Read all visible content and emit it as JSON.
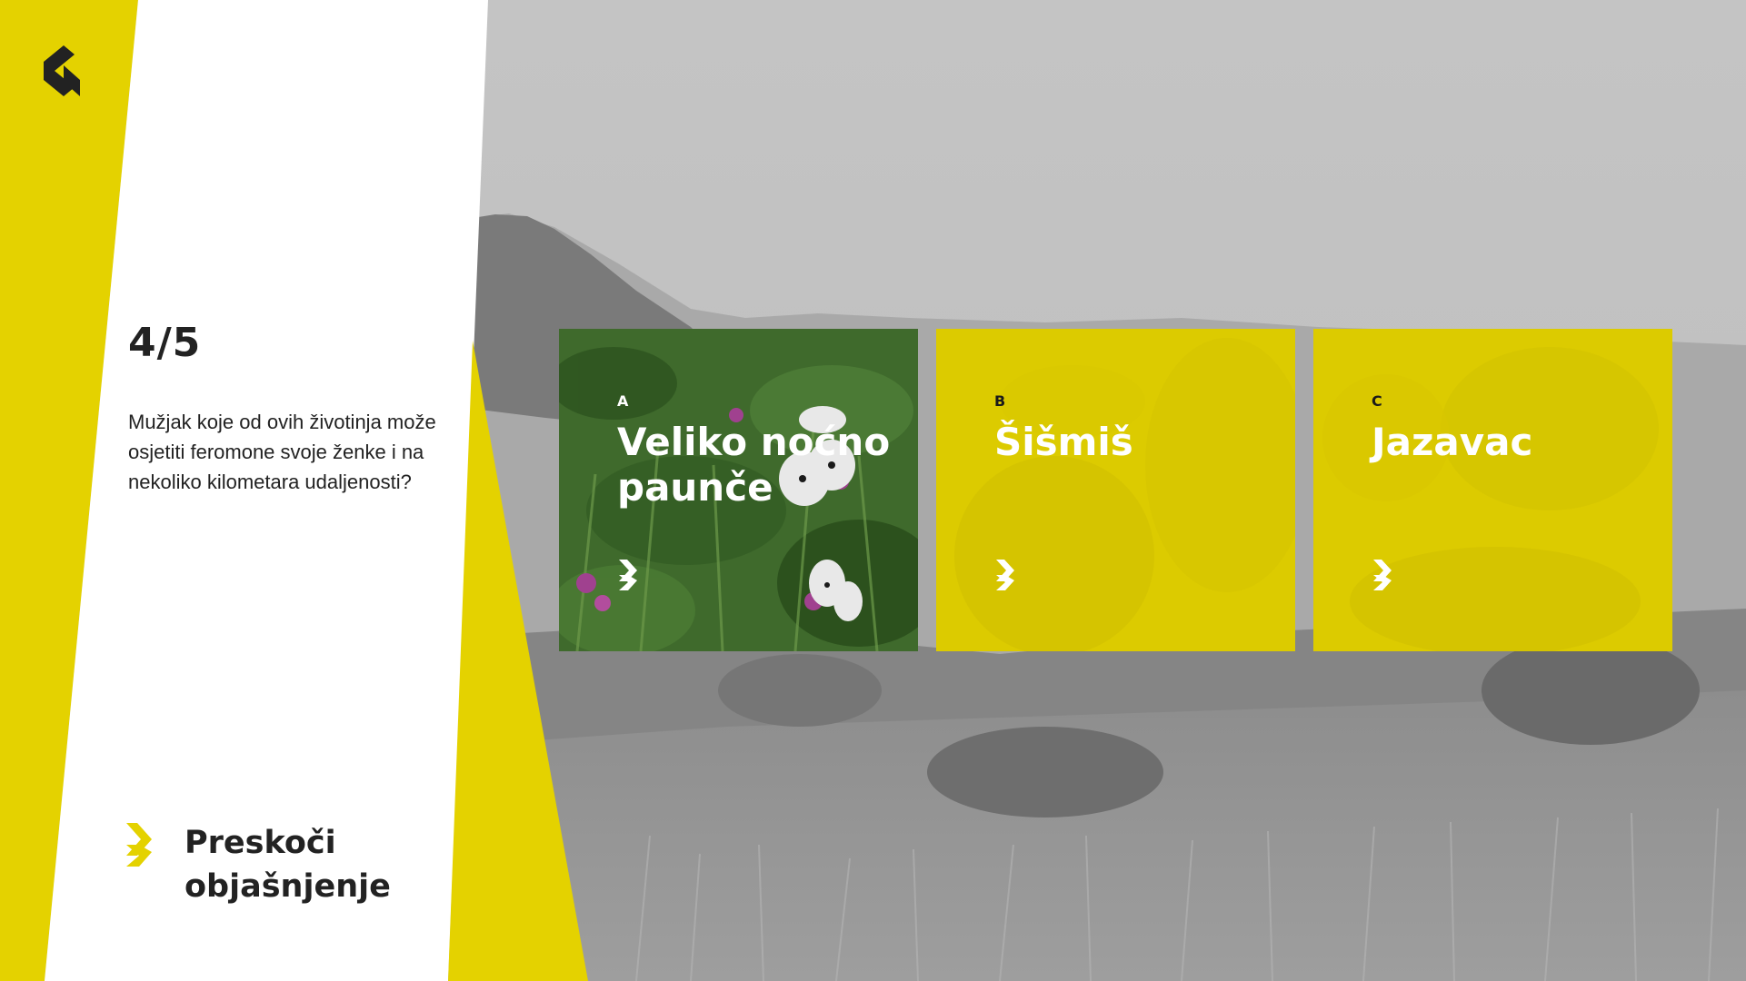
{
  "quiz": {
    "progress": "4/5",
    "question": "Mužjak koje od ovih životinja može osjetiti feromone svoje ženke i na nekoliko kilometara udaljenosti?",
    "skip_label": "Preskoči objašnjenje"
  },
  "answers": [
    {
      "letter": "A",
      "title": "Veliko noćno paunče"
    },
    {
      "letter": "B",
      "title": "Šišmiš"
    },
    {
      "letter": "C",
      "title": "Jazavac"
    }
  ],
  "colors": {
    "accent": "#e4d200",
    "card_yellow": "#dccb00",
    "text_dark": "#222222",
    "panel_white": "#ffffff"
  },
  "icons": {
    "back": "chevron-left-icon",
    "skip": "chevron-right-icon",
    "card_arrow": "chevron-right-icon"
  }
}
